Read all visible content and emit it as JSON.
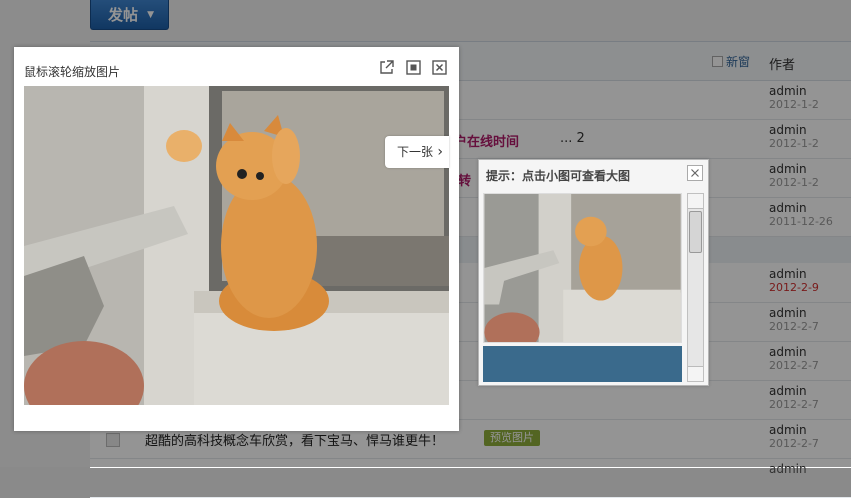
{
  "toolbar": {
    "post_label": "发帖"
  },
  "list": {
    "new_window_label": "新窗",
    "author_header": "作者",
    "rows": [
      {
        "author": "admin",
        "date": "2012-1-2",
        "date_red": false
      },
      {
        "author": "admin",
        "date": "2012-1-2",
        "date_red": false,
        "title_visible": "户在线时间",
        "pages": "... 2"
      },
      {
        "author": "admin",
        "date": "2012-1-2",
        "date_red": false,
        "title_visible": "转"
      },
      {
        "author": "admin",
        "date": "2011-12-26",
        "date_red": false
      },
      {
        "author": "admin",
        "date": "2012-2-9",
        "date_red": true
      },
      {
        "author": "admin",
        "date": "2012-2-7",
        "date_red": false
      },
      {
        "author": "admin",
        "date": "2012-2-7",
        "date_red": false
      },
      {
        "author": "admin",
        "date": "2012-2-7",
        "date_red": false
      },
      {
        "author": "admin",
        "date": "2012-2-7",
        "date_red": false,
        "title": "超酷的高科技概念车欣赏，看下宝马、悍马谁更牛！",
        "tag": "预览图片"
      },
      {
        "author": "admin",
        "date": "",
        "date_red": false
      }
    ]
  },
  "viewer": {
    "caption": "鼠标滚轮缩放图片",
    "next_label": "下一张",
    "photo_icon": "kitten-photo"
  },
  "thumbs": {
    "title": "提示：点击小图可查看大图"
  },
  "colors": {
    "accent": "#2a6ebb",
    "tag_green": "#8fae3c",
    "date_red": "#d03030"
  }
}
